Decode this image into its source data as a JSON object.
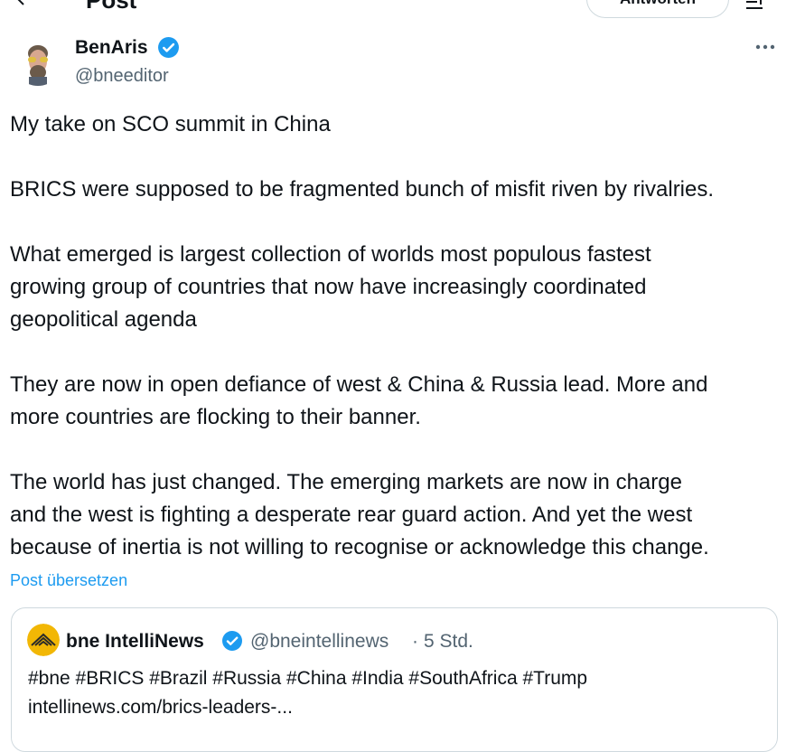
{
  "header": {
    "title": "Post",
    "reply_label": "Antworten"
  },
  "author": {
    "name": "BenAris",
    "handle": "@bneeditor",
    "verified": true
  },
  "post": {
    "paragraphs": [
      "My take on SCO summit in China",
      "BRICS were supposed to be fragmented bunch of misfit riven by rivalries.",
      "What emerged is largest collection of worlds most populous fastest",
      "growing group of countries that now have increasingly coordinated",
      "geopolitical agenda",
      "They are now in open defiance of west & China & Russia lead. More and",
      "more countries are flocking to their banner.",
      "The world has just changed. The emerging markets are now in charge",
      "and the west is fighting a desperate rear guard action.  And yet the west",
      "because of inertia is not willing to recognise or acknowledge this change."
    ],
    "translate_label": "Post übersetzen"
  },
  "quote": {
    "name": "bne IntelliNews",
    "handle": "@bneintellinews",
    "separator": "·",
    "time": "5 Std.",
    "text_line1": "#bne #BRICS #Brazil #Russia #China #India #SouthAfrica #Trump",
    "text_line2": "intellinews.com/brics-leaders-..."
  },
  "colors": {
    "accent": "#1d9bf0",
    "text": "#0f1419",
    "muted": "#536471",
    "border": "#cfd9de"
  },
  "icons": {
    "back": "arrow-left-icon",
    "verified": "verified-badge-icon",
    "more": "more-horizontal-icon",
    "filter": "filter-icon"
  }
}
